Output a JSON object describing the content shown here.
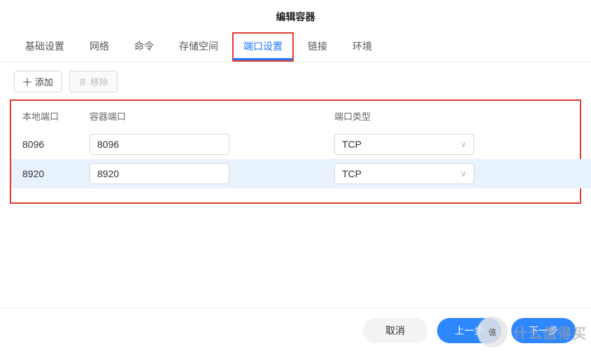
{
  "dialog": {
    "title": "编辑容器"
  },
  "tabs": {
    "items": [
      {
        "label": "基础设置"
      },
      {
        "label": "网络"
      },
      {
        "label": "命令"
      },
      {
        "label": "存储空间"
      },
      {
        "label": "端口设置"
      },
      {
        "label": "链接"
      },
      {
        "label": "环境"
      }
    ],
    "activeIndex": 4
  },
  "toolbar": {
    "add_label": "添加",
    "remove_label": "移除"
  },
  "table": {
    "headers": {
      "local": "本地端口",
      "container": "容器端口",
      "type": "端口类型"
    },
    "rows": [
      {
        "local": "8096",
        "container": "8096",
        "type": "TCP",
        "selected": false
      },
      {
        "local": "8920",
        "container": "8920",
        "type": "TCP",
        "selected": true
      }
    ]
  },
  "footer": {
    "cancel": "取消",
    "prev": "上一步",
    "next": "下一步"
  },
  "watermark": {
    "circle": "值",
    "text": "什么值得买"
  }
}
